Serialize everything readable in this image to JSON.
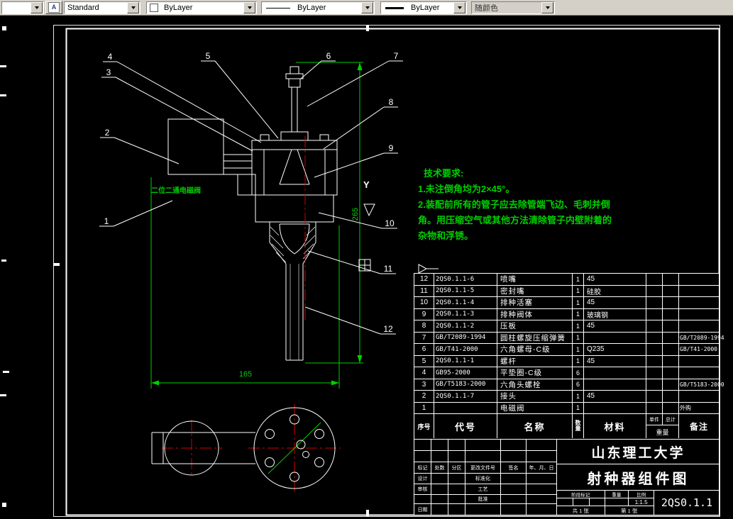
{
  "toolbar": {
    "layer_value": "",
    "style_label": "Standard",
    "color_label": "ByLayer",
    "linetype_label": "ByLayer",
    "lineweight_label": "ByLayer",
    "plotstyle_label": "随颜色"
  },
  "colors": {
    "dimension_green": "#00d000",
    "centerline_red": "#d40000",
    "line_white": "#ffffff",
    "toolbar_gray": "#d4d0c8"
  },
  "annotations": {
    "solenoid_label": "二位二通电磁阀",
    "tech_title": "技术要求:",
    "tech_line1": "1.未注倒角均为2×45°。",
    "tech_line2": "2.装配前所有的管子应去除管端飞边、毛刺并倒",
    "tech_line3": "角。用压缩空气或其他方法清除管子内壁附着的",
    "tech_line4": "杂物和浮锈。",
    "dim_width": "165",
    "dim_height": "265",
    "section_label": "Y"
  },
  "callouts": [
    "1",
    "2",
    "3",
    "4",
    "5",
    "6",
    "7",
    "8",
    "9",
    "10",
    "11",
    "12"
  ],
  "bom": {
    "headers": {
      "no": "序号",
      "code": "代号",
      "name": "名称",
      "qty": "数量",
      "material": "材料",
      "unit": "单件",
      "total": "总计",
      "weight": "重量",
      "remark": "备注"
    },
    "rows": [
      {
        "no": "12",
        "code": "2QS0.1.1-6",
        "name": "喷嘴",
        "qty": "1",
        "material": "45",
        "unit": "",
        "total": "",
        "remark": ""
      },
      {
        "no": "11",
        "code": "2QS0.1.1-5",
        "name": "密封嘴",
        "qty": "1",
        "material": "硅胶",
        "unit": "",
        "total": "",
        "remark": ""
      },
      {
        "no": "10",
        "code": "2QS0.1.1-4",
        "name": "排种活塞",
        "qty": "1",
        "material": "45",
        "unit": "",
        "total": "",
        "remark": ""
      },
      {
        "no": "9",
        "code": "2QS0.1.1-3",
        "name": "排种阀体",
        "qty": "1",
        "material": "玻璃钢",
        "unit": "",
        "total": "",
        "remark": ""
      },
      {
        "no": "8",
        "code": "2QS0.1.1-2",
        "name": "压板",
        "qty": "1",
        "material": "45",
        "unit": "",
        "total": "",
        "remark": ""
      },
      {
        "no": "7",
        "code": "GB/T2089-1994",
        "name": "圆柱螺旋压缩弹簧",
        "qty": "1",
        "material": "",
        "unit": "",
        "total": "",
        "remark": "GB/T2089-1994"
      },
      {
        "no": "6",
        "code": "GB/T41-2000",
        "name": "六角螺母-C级",
        "qty": "1",
        "material": "Q235",
        "unit": "",
        "total": "",
        "remark": "GB/T41-2000"
      },
      {
        "no": "5",
        "code": "2QS0.1.1-1",
        "name": "螺杆",
        "qty": "1",
        "material": "45",
        "unit": "",
        "total": "",
        "remark": ""
      },
      {
        "no": "4",
        "code": "GB95-2000",
        "name": "平垫圈-C级",
        "qty": "6",
        "material": "",
        "unit": "",
        "total": "",
        "remark": ""
      },
      {
        "no": "3",
        "code": "GB/T5183-2000",
        "name": "六角头螺栓",
        "qty": "6",
        "material": "",
        "unit": "",
        "total": "",
        "remark": "GB/T5183-2000"
      },
      {
        "no": "2",
        "code": "2QS0.1.1-7",
        "name": "接头",
        "qty": "1",
        "material": "45",
        "unit": "",
        "total": "",
        "remark": ""
      },
      {
        "no": "1",
        "code": "",
        "name": "电磁阀",
        "qty": "1",
        "material": "",
        "unit": "",
        "total": "",
        "remark": "外购"
      }
    ]
  },
  "titleblock": {
    "university": "山东理工大学",
    "drawing_title": "射种器组件图",
    "drawing_no": "2QS0.1.1",
    "scale_value": "1:1.5",
    "sheets_total": "共 1 张",
    "sheet_no": "第 1 张",
    "labels": {
      "mark": "标记",
      "count": "处数",
      "zone": "分区",
      "change_doc": "更改文件号",
      "sign": "签名",
      "date_ymd": "年、月、日",
      "design": "设计",
      "standardize": "标准化",
      "check": "审核",
      "process": "工艺",
      "approve": "批准",
      "date": "日期",
      "stage": "阶段标记",
      "weight": "重量",
      "scale": "比例"
    }
  }
}
